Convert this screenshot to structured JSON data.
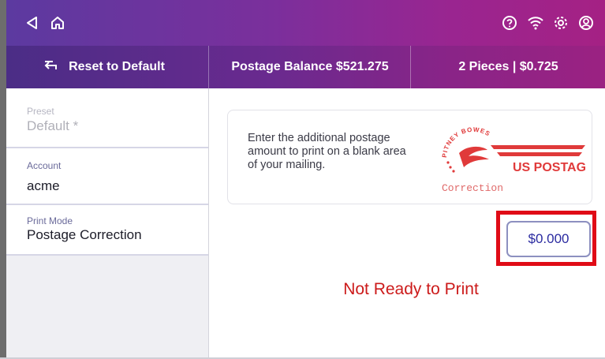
{
  "topbar": {
    "icons": [
      "back-triangle-icon",
      "home-icon",
      "help-icon",
      "wifi-icon",
      "settings-gear-icon",
      "account-icon"
    ]
  },
  "subbar": {
    "reset_label": "Reset to Default",
    "balance_label": "Postage Balance $521.275",
    "pieces_label": "2 Pieces | $0.725"
  },
  "sidebar": {
    "items": [
      {
        "label": "Preset",
        "value": "Default *",
        "faded": true
      },
      {
        "label": "Account",
        "value": "acme",
        "faded": false
      },
      {
        "label": "Print Mode",
        "value": "Postage Correction",
        "faded": false
      }
    ]
  },
  "main": {
    "instruction_line1": "Enter the additional postage",
    "instruction_line2": "amount to print on a blank area",
    "instruction_line3": "of your mailing.",
    "stamp_brand": "US POSTAGE",
    "stamp_arc": "PITNEY BOWES",
    "stamp_type": "Correction",
    "amount_value": "$0.000",
    "status_text": "Not Ready to Print"
  },
  "colors": {
    "accent_purple": "#5b3aa0",
    "accent_magenta": "#a52184",
    "status_red": "#cc1b1b",
    "highlight_red": "#e00b16",
    "button_text": "#2a2aa0"
  }
}
